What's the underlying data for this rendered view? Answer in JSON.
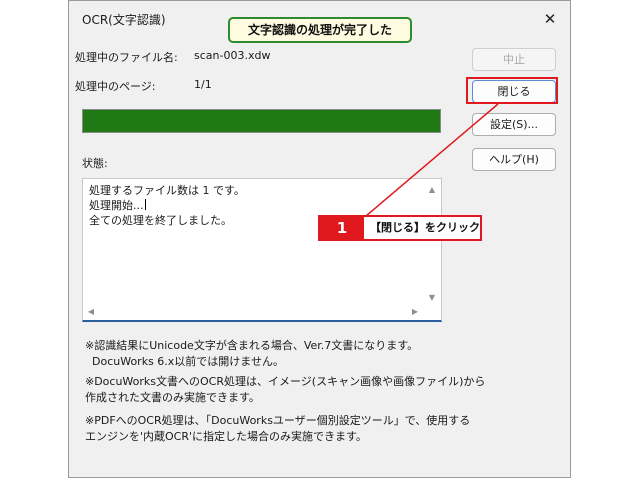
{
  "dialog": {
    "title": "OCR(文字認識)",
    "close_glyph": "✕",
    "file_label": "処理中のファイル名:",
    "file_value": "scan-003.xdw",
    "page_label": "処理中のページ:",
    "page_value": "1/1",
    "progress": 1.0,
    "progress_color": "#1f7a16",
    "status_label": "状態:",
    "status_lines": [
      "処理するファイル数は 1 です。",
      "処理開始...",
      "全ての処理を終了しました。"
    ],
    "buttons": {
      "stop": "中止",
      "close": "閉じる",
      "settings": "設定(S)...",
      "help": "ヘルプ(H)"
    },
    "notes": [
      [
        "※認識結果にUnicode文字が含まれる場合、Ver.7文書になります。",
        "DocuWorks 6.x以前では開けません。"
      ],
      [
        "※DocuWorks文書へのOCR処理は、イメージ(スキャン画像や画像ファイル)から",
        "作成された文書のみ実施できます。"
      ],
      [
        "※PDFへのOCR処理は、「DocuWorksユーザー個別設定ツール」で、使用する",
        "エンジンを'内蔵OCR'に指定した場合のみ実施できます。"
      ]
    ]
  },
  "annotations": {
    "top_callout": "文字認識の処理が完了した",
    "step_number": "1",
    "step_text": "【閉じる】をクリック",
    "accent_red": "#e0191f",
    "accent_green": "#2e8c2e"
  }
}
